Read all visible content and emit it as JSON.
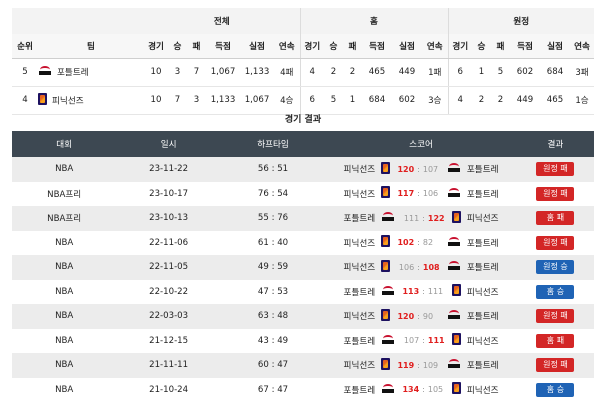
{
  "standings": {
    "groups": {
      "total": "전체",
      "home": "홈",
      "away": "원정"
    },
    "headers": [
      "순위",
      "팀",
      "경기",
      "승",
      "패",
      "득점",
      "실점",
      "연속",
      "경기",
      "승",
      "패",
      "득점",
      "실점",
      "연속",
      "경기",
      "승",
      "패",
      "득점",
      "실점",
      "연속"
    ],
    "rows": [
      {
        "rank": "5",
        "team": "포틀트레",
        "logo": "portland-logo",
        "cells": [
          "10",
          "3",
          "7",
          "1,067",
          "1,133",
          "4패",
          "4",
          "2",
          "2",
          "465",
          "449",
          "1패",
          "6",
          "1",
          "5",
          "602",
          "684",
          "3패"
        ]
      },
      {
        "rank": "4",
        "team": "피닉선즈",
        "logo": "phoenix-logo",
        "cells": [
          "10",
          "7",
          "3",
          "1,133",
          "1,067",
          "4승",
          "6",
          "5",
          "1",
          "684",
          "602",
          "3승",
          "4",
          "2",
          "2",
          "449",
          "465",
          "1승"
        ]
      }
    ]
  },
  "results": {
    "title": "경기 결과",
    "headers": [
      "대회",
      "일시",
      "하프타임",
      "스코어",
      "결과"
    ],
    "rows": [
      {
        "league": "NBA",
        "date": "23-11-22",
        "half": "56 : 51",
        "home": "피닉선즈",
        "home_logo": "phx",
        "hs": "120",
        "as": "107",
        "away": "포틀트레",
        "away_logo": "por",
        "hs_win": true,
        "result": "원정 패",
        "type": "loss"
      },
      {
        "league": "NBA프리",
        "date": "23-10-17",
        "half": "76 : 54",
        "home": "피닉선즈",
        "home_logo": "phx",
        "hs": "117",
        "as": "106",
        "away": "포틀트레",
        "away_logo": "por",
        "hs_win": true,
        "result": "원정 패",
        "type": "loss"
      },
      {
        "league": "NBA프리",
        "date": "23-10-13",
        "half": "55 : 76",
        "home": "포틀트레",
        "home_logo": "por",
        "hs": "111",
        "as": "122",
        "away": "피닉선즈",
        "away_logo": "phx",
        "hs_win": false,
        "result": "홈 패",
        "type": "loss"
      },
      {
        "league": "NBA",
        "date": "22-11-06",
        "half": "61 : 40",
        "home": "피닉선즈",
        "home_logo": "phx",
        "hs": "102",
        "as": "82",
        "away": "포틀트레",
        "away_logo": "por",
        "hs_win": true,
        "result": "원정 패",
        "type": "loss"
      },
      {
        "league": "NBA",
        "date": "22-11-05",
        "half": "49 : 59",
        "home": "피닉선즈",
        "home_logo": "phx",
        "hs": "106",
        "as": "108",
        "away": "포틀트레",
        "away_logo": "por",
        "hs_win": false,
        "result": "원정 승",
        "type": "win"
      },
      {
        "league": "NBA",
        "date": "22-10-22",
        "half": "47 : 53",
        "home": "포틀트레",
        "home_logo": "por",
        "hs": "113",
        "as": "111",
        "away": "피닉선즈",
        "away_logo": "phx",
        "hs_win": true,
        "result": "홈 승",
        "type": "win"
      },
      {
        "league": "NBA",
        "date": "22-03-03",
        "half": "63 : 48",
        "home": "피닉선즈",
        "home_logo": "phx",
        "hs": "120",
        "as": "90",
        "away": "포틀트레",
        "away_logo": "por",
        "hs_win": true,
        "result": "원정 패",
        "type": "loss"
      },
      {
        "league": "NBA",
        "date": "21-12-15",
        "half": "43 : 49",
        "home": "포틀트레",
        "home_logo": "por",
        "hs": "107",
        "as": "111",
        "away": "피닉선즈",
        "away_logo": "phx",
        "hs_win": false,
        "result": "홈 패",
        "type": "loss"
      },
      {
        "league": "NBA",
        "date": "21-11-11",
        "half": "60 : 47",
        "home": "피닉선즈",
        "home_logo": "phx",
        "hs": "119",
        "as": "109",
        "away": "포틀트레",
        "away_logo": "por",
        "hs_win": true,
        "result": "원정 패",
        "type": "loss"
      },
      {
        "league": "NBA",
        "date": "21-10-24",
        "half": "67 : 47",
        "home": "포틀트레",
        "home_logo": "por",
        "hs": "134",
        "as": "105",
        "away": "피닉선즈",
        "away_logo": "phx",
        "hs_win": true,
        "result": "홈 승",
        "type": "win"
      }
    ]
  },
  "colors": {
    "header_bg": "#3d4852",
    "loss": "#d32626",
    "win": "#1f63b5",
    "score_win": "#e01e1e"
  }
}
